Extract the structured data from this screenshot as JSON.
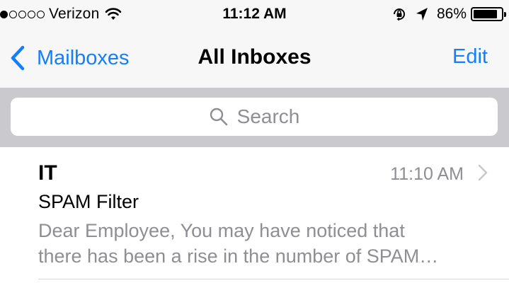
{
  "status_bar": {
    "carrier": "Verizon",
    "time": "11:12 AM",
    "battery_percent": "86%",
    "battery_level": 0.86,
    "signal_bars_filled": 1,
    "signal_bars_total": 5
  },
  "nav": {
    "back_label": "Mailboxes",
    "title": "All Inboxes",
    "edit_label": "Edit"
  },
  "search": {
    "placeholder": "Search"
  },
  "messages": [
    {
      "sender": "IT",
      "time": "11:10 AM",
      "subject": "SPAM Filter",
      "preview_line1": "Dear Employee, You may have noticed that",
      "preview_line2": "there has been a rise in the number of SPAM…"
    }
  ],
  "colors": {
    "accent": "#157efb",
    "secondary_text": "#8e8e93",
    "search_bg": "#c9c9ce",
    "bar_bg": "#f7f7f8"
  },
  "icons": {
    "back": "chevron-left-icon",
    "search": "search-icon",
    "disclosure": "chevron-right-icon",
    "wifi": "wifi-icon",
    "orientation_lock": "orientation-lock-icon",
    "location": "location-arrow-icon",
    "battery": "battery-icon"
  }
}
